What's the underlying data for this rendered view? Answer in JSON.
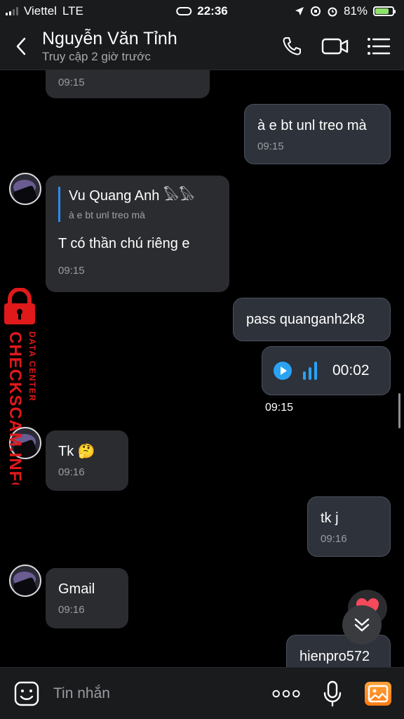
{
  "status_bar": {
    "carrier": "Viettel",
    "network": "LTE",
    "time": "22:36",
    "battery_percent": "81%",
    "battery_level": 0.81
  },
  "header": {
    "contact_name": "Nguyễn Văn Tỉnh",
    "last_seen": "Truy cập 2 giờ trước",
    "icons": [
      "back-icon",
      "phone-icon",
      "video-call-icon",
      "menu-icon"
    ]
  },
  "messages": [
    {
      "id": "m0",
      "direction": "in",
      "time": "09:15"
    },
    {
      "id": "m1",
      "direction": "out",
      "text": "à e bt unl treo mà",
      "time": "09:15"
    },
    {
      "id": "m2",
      "direction": "in",
      "reply_to_name": "Vu Quang Anh 𓅃𓅃",
      "reply_to_text": "à e bt unl treo mà",
      "text": "T có thần chú riêng e",
      "time": "09:15"
    },
    {
      "id": "m3",
      "direction": "out",
      "text": "pass quanganh2k8"
    },
    {
      "id": "m4",
      "direction": "out",
      "type": "voice",
      "duration": "00:02",
      "time": "09:15"
    },
    {
      "id": "m5",
      "direction": "in",
      "text": "Tk 🤔",
      "time": "09:16"
    },
    {
      "id": "m6",
      "direction": "out",
      "text": "tk j",
      "time": "09:16"
    },
    {
      "id": "m7",
      "direction": "in",
      "text": "Gmail",
      "time": "09:16"
    },
    {
      "id": "m8",
      "direction": "out",
      "text": "hienpro572"
    }
  ],
  "watermark": {
    "line1": "CHECKSCAM.INFO",
    "line2": "DATA CENTER",
    "color": "#e0191b"
  },
  "composer": {
    "placeholder": "Tin nhắn",
    "more_label": "ooo"
  },
  "colors": {
    "background": "#000000",
    "bubble_in": "#2b2c30",
    "bubble_out": "#2e323a",
    "accent": "#2aa3f5"
  }
}
